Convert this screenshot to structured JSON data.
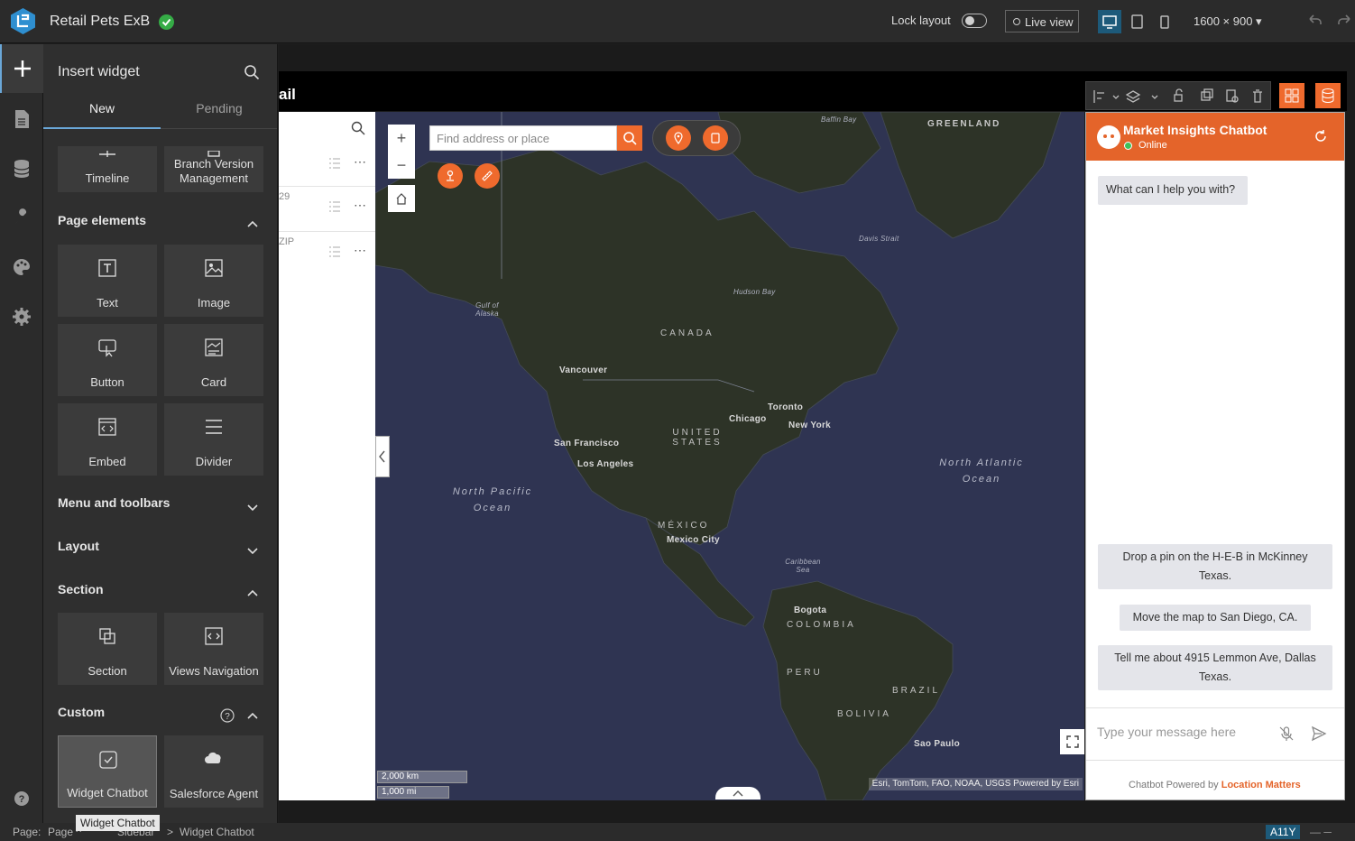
{
  "app": {
    "title": "Retail Pets ExB",
    "lock_layout_label": "Lock layout",
    "live_view_label": "Live view",
    "resolution": "1600 × 900"
  },
  "rail": {
    "items": [
      "insert-icon",
      "page-icon",
      "data-icon",
      "tools-icon",
      "theme-icon",
      "settings-icon",
      "help-icon"
    ]
  },
  "panel": {
    "title": "Insert widget",
    "tabs": {
      "new": "New",
      "pending": "Pending"
    },
    "top_tiles": [
      "Timeline",
      "Branch Version Management"
    ],
    "sections": {
      "page_elements": "Page elements",
      "menu_toolbars": "Menu and toolbars",
      "layout": "Layout",
      "section": "Section",
      "custom": "Custom"
    },
    "page_element_tiles": [
      "Text",
      "Image",
      "Button",
      "Card",
      "Embed",
      "Divider"
    ],
    "section_tiles": [
      "Section",
      "Views Navigation"
    ],
    "custom_tiles": [
      "Widget Chatbot",
      "Salesforce Agent"
    ],
    "tooltip": "Widget Chatbot"
  },
  "canvas": {
    "header_text": "ail",
    "list_rows": [
      {
        "text": ""
      },
      {
        "text": "29"
      },
      {
        "text": "ZIP"
      }
    ]
  },
  "map": {
    "search_placeholder": "Find address or place",
    "zoom_in": "+",
    "zoom_out": "−",
    "labels": {
      "greenland": "GREENLAND",
      "baffin": "Baffin Bay",
      "davis": "Davis Strait",
      "hudson": "Hudson Bay",
      "alaska_gulf": "Gulf of Alaska",
      "canada": "CANADA",
      "vancouver": "Vancouver",
      "toronto": "Toronto",
      "chicago": "Chicago",
      "new_york": "New York",
      "united_states": "UNITED STATES",
      "san_francisco": "San Francisco",
      "los_angeles": "Los Angeles",
      "north_pacific": "North Pacific Ocean",
      "north_atlantic": "North Atlantic Ocean",
      "mexico": "MÉXICO",
      "mexico_city": "Mexico City",
      "caribbean": "Caribbean Sea",
      "bogota": "Bogota",
      "colombia": "COLOMBIA",
      "peru": "PERU",
      "brazil": "BRAZIL",
      "bolivia": "BOLIVIA",
      "sao_paulo": "Sao Paulo"
    },
    "scale_km": "2,000 km",
    "scale_mi": "1,000 mi",
    "attribution": "Esri, TomTom, FAO, NOAA, USGS    Powered by Esri"
  },
  "chat": {
    "title": "Market Insights Chatbot",
    "status": "Online",
    "greeting": "What can I help you with?",
    "suggestions": [
      "Drop a pin on the H-E-B in McKinney Texas.",
      "Move the map to San Diego, CA.",
      "Tell me about 4915 Lemmon Ave, Dallas Texas."
    ],
    "input_placeholder": "Type your message here",
    "footer_prefix": "Chatbot Powered by ",
    "footer_brand": "Location Matters"
  },
  "statusbar": {
    "page_label": "Page:",
    "page_value": "Page",
    "breadcrumb_1": "Sidebar",
    "breadcrumb_sep": ">",
    "breadcrumb_2": "Widget Chatbot",
    "a11y": "A11Y"
  },
  "colors": {
    "accent_orange": "#e4642a",
    "accent_blue": "#6aa7d8",
    "success_green": "#35ac46"
  }
}
